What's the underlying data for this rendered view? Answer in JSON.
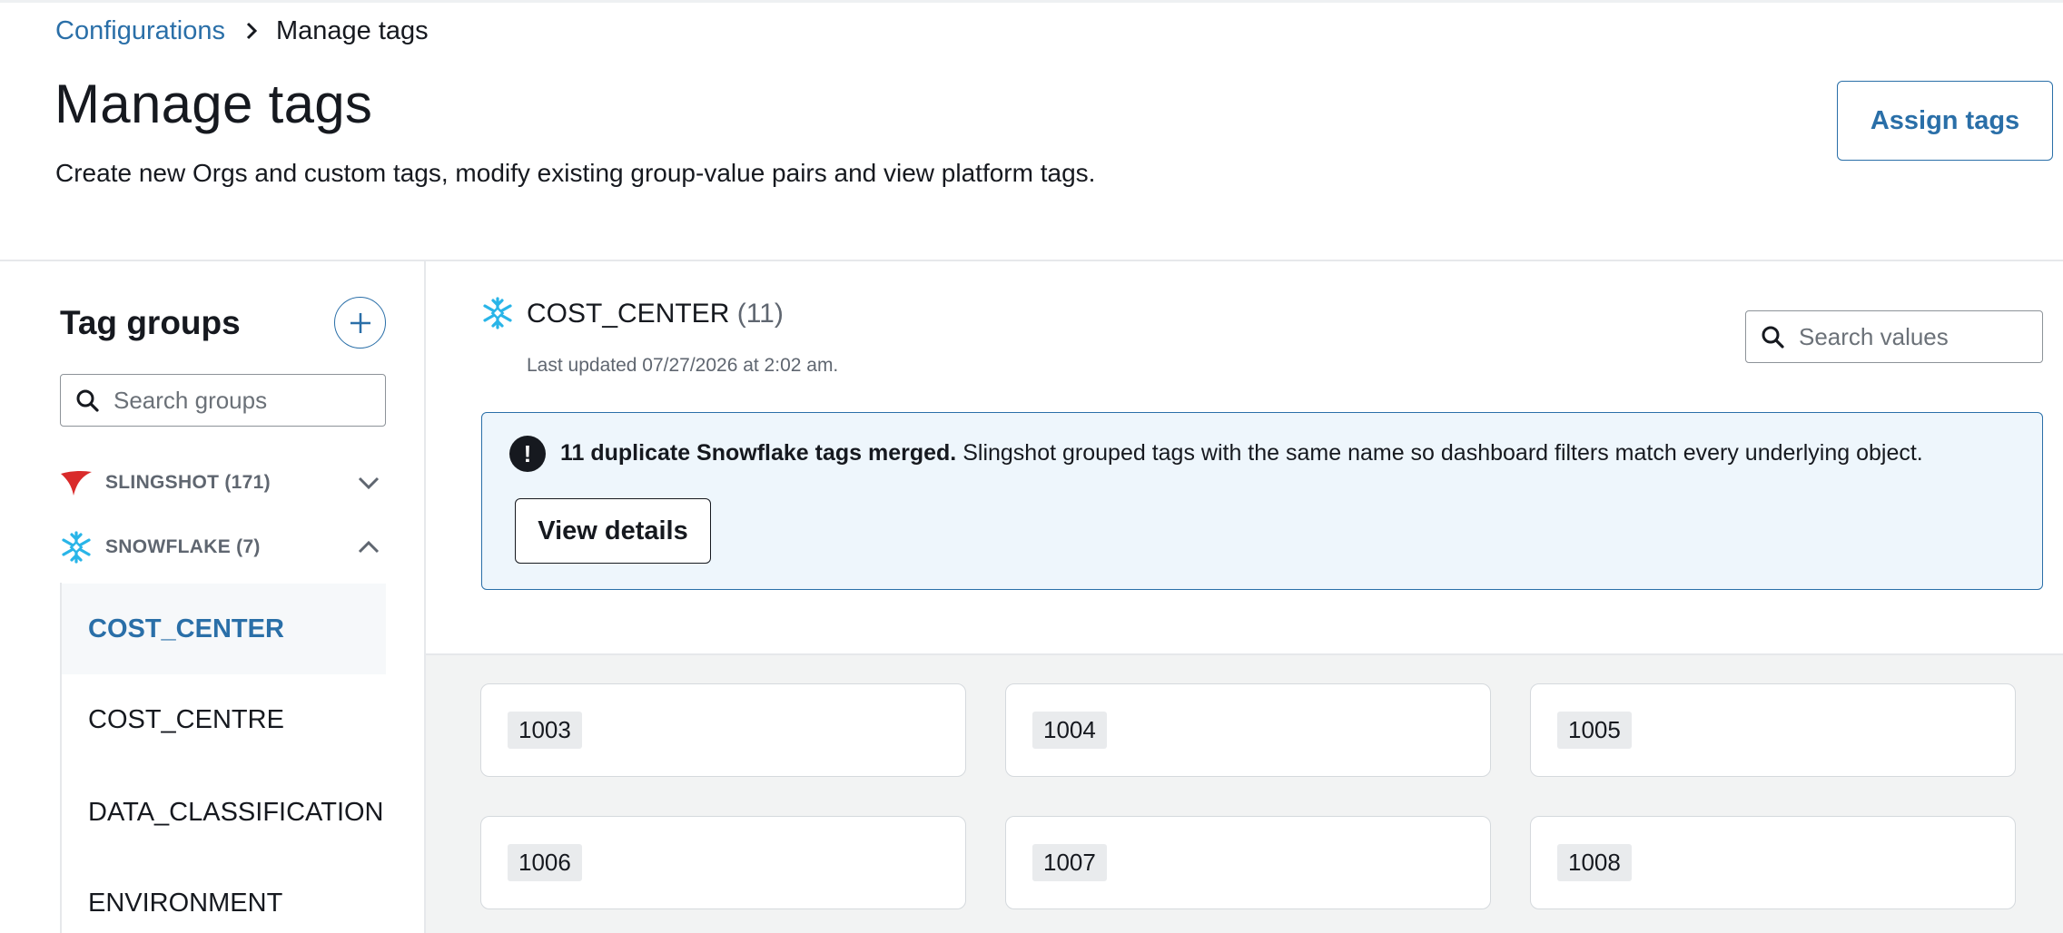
{
  "breadcrumb": {
    "parent": "Configurations",
    "current": "Manage tags"
  },
  "header": {
    "title": "Manage tags",
    "description": "Create new Orgs and custom tags, modify existing group-value pairs and view platform tags.",
    "assign_button": "Assign tags"
  },
  "sidebar": {
    "title": "Tag groups",
    "search_placeholder": "Search groups",
    "groups": [
      {
        "label": "SLINGSHOT (171)",
        "icon": "slingshot-logo-icon",
        "expanded": false
      },
      {
        "label": "SNOWFLAKE (7)",
        "icon": "snowflake-icon",
        "expanded": true
      }
    ],
    "tags": [
      {
        "label": "COST_CENTER",
        "active": true
      },
      {
        "label": "COST_CENTRE",
        "active": false
      },
      {
        "label": "DATA_CLASSIFICATION",
        "active": false
      },
      {
        "label": "ENVIRONMENT",
        "active": false
      }
    ]
  },
  "main": {
    "tag_name": "COST_CENTER",
    "tag_count": "(11)",
    "last_updated": "Last updated 07/27/2026 at 2:02 am.",
    "search_placeholder": "Search values",
    "alert": {
      "bold": "11 duplicate Snowflake tags merged.",
      "text": " Slingshot grouped tags with the same name so dashboard filters match every underlying object.",
      "button": "View details"
    },
    "values": [
      "1003",
      "1004",
      "1005",
      "1006",
      "1007",
      "1008"
    ]
  },
  "colors": {
    "accent": "#2a6fa8",
    "snowflake": "#29b5e8",
    "slingshot": "#d92b2b",
    "alert_bg": "#eef6fc"
  }
}
